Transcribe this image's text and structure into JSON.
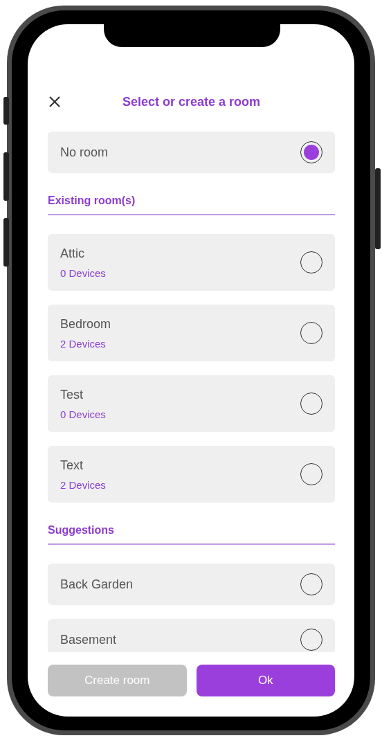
{
  "title": "Select or create a room",
  "no_room": {
    "label": "No room",
    "selected": true
  },
  "sections": [
    {
      "heading": "Existing room(s)",
      "rooms": [
        {
          "name": "Attic",
          "devices": "0 Devices",
          "selected": false
        },
        {
          "name": "Bedroom",
          "devices": "2 Devices",
          "selected": false
        },
        {
          "name": "Test",
          "devices": "0 Devices",
          "selected": false
        },
        {
          "name": "Text",
          "devices": "2 Devices",
          "selected": false
        }
      ]
    },
    {
      "heading": "Suggestions",
      "rooms": [
        {
          "name": "Back Garden",
          "selected": false
        },
        {
          "name": "Basement",
          "selected": false
        }
      ]
    }
  ],
  "buttons": [
    {
      "label": "Create room",
      "disabled": true
    },
    {
      "label": "Ok",
      "disabled": false
    }
  ]
}
